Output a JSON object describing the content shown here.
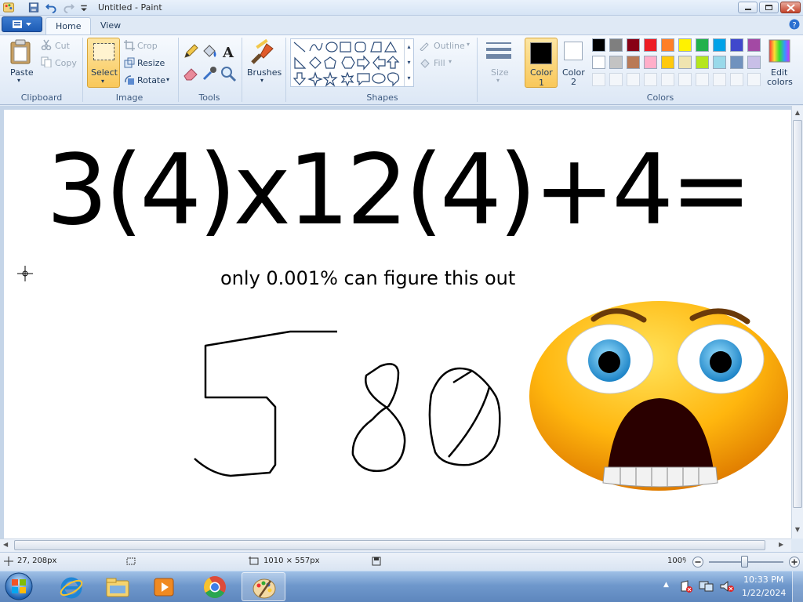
{
  "window": {
    "title": "Untitled - Paint"
  },
  "tabs": [
    {
      "label": "Home",
      "active": true
    },
    {
      "label": "View",
      "active": false
    }
  ],
  "ribbon": {
    "clipboard": {
      "paste": "Paste",
      "cut": "Cut",
      "copy": "Copy",
      "group": "Clipboard"
    },
    "image": {
      "select": "Select",
      "crop": "Crop",
      "resize": "Resize",
      "rotate": "Rotate",
      "group": "Image"
    },
    "tools": {
      "group": "Tools"
    },
    "brushes": {
      "label": "Brushes"
    },
    "shapes": {
      "outline": "Outline",
      "fill": "Fill",
      "group": "Shapes"
    },
    "size": {
      "label": "Size"
    },
    "color1": {
      "label": "Color",
      "num": "1"
    },
    "color2": {
      "label": "Color",
      "num": "2"
    },
    "colors": {
      "group": "Colors",
      "edit": "Edit",
      "edit2": "colors"
    },
    "palette_row1": [
      "#000000",
      "#7f7f7f",
      "#880015",
      "#ed1c24",
      "#ff7f27",
      "#fff200",
      "#22b14c",
      "#00a2e8",
      "#3f48cc",
      "#a349a4"
    ],
    "palette_row2": [
      "#ffffff",
      "#c3c3c3",
      "#b97a57",
      "#ffaec9",
      "#ffc90e",
      "#efe4b0",
      "#b5e61d",
      "#99d9ea",
      "#7092be",
      "#c8bfe7"
    ]
  },
  "canvas": {
    "equation": "3(4)x12(4)+4=",
    "subtitle": "only 0.001% can figure this out",
    "handwritten_answer": "580"
  },
  "statusbar": {
    "cursor_pos": "27, 208px",
    "image_size": "1010 × 557px",
    "zoom": "100%"
  },
  "taskbar": {
    "time": "10:33 PM",
    "date": "1/22/2024"
  }
}
